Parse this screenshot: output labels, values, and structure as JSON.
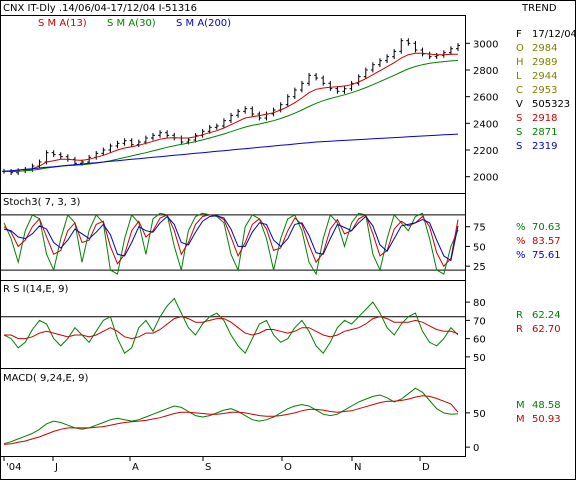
{
  "header": {
    "title": "CNX IT-Dly .14/06/04-17/12/04  I-51316",
    "trend": "TREND"
  },
  "colors": {
    "price": "#000000",
    "sma13": "#cc0000",
    "sma30": "#008000",
    "sma200": "#0000cc",
    "olive": "#808000",
    "frame": "#000000",
    "background": "#ffffff"
  },
  "chart_data": [
    {
      "type": "line",
      "panel": "price",
      "series_labels": [
        {
          "name": "S M A(13)",
          "color": "#cc0000"
        },
        {
          "name": "S M A(30)",
          "color": "#008000"
        },
        {
          "name": "S M A(200)",
          "color": "#0000cc"
        }
      ],
      "ylim": [
        1900,
        3100
      ],
      "yticks": [
        2000,
        2200,
        2400,
        2600,
        2800,
        3000
      ],
      "grid": false,
      "close": [
        2040,
        2030,
        2045,
        2055,
        2080,
        2110,
        2180,
        2165,
        2150,
        2130,
        2100,
        2110,
        2145,
        2175,
        2200,
        2230,
        2250,
        2270,
        2240,
        2260,
        2290,
        2310,
        2330,
        2310,
        2290,
        2260,
        2275,
        2310,
        2340,
        2370,
        2380,
        2420,
        2460,
        2490,
        2510,
        2470,
        2440,
        2470,
        2500,
        2540,
        2600,
        2650,
        2700,
        2760,
        2740,
        2700,
        2660,
        2640,
        2660,
        2700,
        2750,
        2800,
        2840,
        2870,
        2900,
        2940,
        3020,
        3000,
        2950,
        2920,
        2900,
        2910,
        2930,
        2960,
        2984
      ],
      "sma13": [
        2040,
        2038,
        2040,
        2045,
        2060,
        2080,
        2110,
        2120,
        2130,
        2130,
        2125,
        2122,
        2130,
        2145,
        2160,
        2180,
        2200,
        2215,
        2225,
        2235,
        2250,
        2265,
        2280,
        2290,
        2292,
        2290,
        2290,
        2300,
        2315,
        2330,
        2345,
        2365,
        2390,
        2415,
        2440,
        2450,
        2458,
        2468,
        2480,
        2500,
        2525,
        2555,
        2590,
        2630,
        2655,
        2665,
        2670,
        2675,
        2680,
        2690,
        2710,
        2735,
        2765,
        2795,
        2825,
        2855,
        2890,
        2915,
        2925,
        2925,
        2920,
        2915,
        2915,
        2918,
        2918
      ],
      "sma30": [
        2040,
        2040,
        2042,
        2044,
        2048,
        2055,
        2065,
        2072,
        2078,
        2083,
        2086,
        2090,
        2095,
        2102,
        2110,
        2120,
        2132,
        2144,
        2156,
        2168,
        2180,
        2193,
        2207,
        2220,
        2232,
        2242,
        2252,
        2263,
        2276,
        2290,
        2305,
        2320,
        2337,
        2355,
        2372,
        2385,
        2395,
        2407,
        2420,
        2436,
        2455,
        2476,
        2500,
        2526,
        2550,
        2570,
        2586,
        2600,
        2614,
        2630,
        2648,
        2668,
        2690,
        2713,
        2737,
        2760,
        2785,
        2808,
        2826,
        2840,
        2850,
        2857,
        2863,
        2868,
        2871
      ],
      "sma200": [
        2040,
        2045,
        2050,
        2055,
        2060,
        2065,
        2070,
        2075,
        2080,
        2085,
        2090,
        2095,
        2100,
        2105,
        2110,
        2115,
        2120,
        2125,
        2130,
        2135,
        2140,
        2145,
        2150,
        2155,
        2160,
        2165,
        2170,
        2175,
        2180,
        2185,
        2190,
        2195,
        2200,
        2205,
        2210,
        2215,
        2220,
        2225,
        2230,
        2235,
        2240,
        2245,
        2250,
        2255,
        2260,
        2263,
        2266,
        2269,
        2272,
        2275,
        2278,
        2281,
        2284,
        2287,
        2290,
        2293,
        2296,
        2299,
        2302,
        2305,
        2308,
        2311,
        2314,
        2316,
        2319
      ],
      "readout": [
        {
          "label": "F",
          "value": "17/12/04",
          "color": "#000000"
        },
        {
          "label": "O",
          "value": "2984",
          "color": "#808000"
        },
        {
          "label": "H",
          "value": "2989",
          "color": "#808000"
        },
        {
          "label": "L",
          "value": "2944",
          "color": "#808000"
        },
        {
          "label": "C",
          "value": "2953",
          "color": "#808000"
        },
        {
          "label": "V",
          "value": "505323",
          "color": "#000000"
        },
        {
          "label": "S",
          "value": "2918",
          "color": "#cc0000"
        },
        {
          "label": "S",
          "value": "2871",
          "color": "#008000"
        },
        {
          "label": "S",
          "value": "2319",
          "color": "#0000cc"
        }
      ]
    },
    {
      "type": "line",
      "panel": "stochastic",
      "title": "Stoch3( 7, 3, 3)",
      "ylim": [
        10,
        100
      ],
      "yticks": [
        25,
        50,
        75
      ],
      "hlines": [
        90,
        20
      ],
      "fast_k": [
        80,
        60,
        30,
        70,
        90,
        85,
        40,
        20,
        60,
        90,
        80,
        30,
        70,
        90,
        80,
        20,
        15,
        60,
        90,
        80,
        40,
        85,
        92,
        90,
        50,
        20,
        70,
        88,
        92,
        90,
        88,
        80,
        40,
        20,
        75,
        90,
        85,
        60,
        20,
        60,
        85,
        90,
        70,
        30,
        15,
        60,
        90,
        80,
        50,
        80,
        92,
        90,
        40,
        20,
        60,
        90,
        80,
        70,
        88,
        92,
        60,
        20,
        15,
        50,
        71
      ],
      "slow_k": [
        75,
        68,
        50,
        58,
        75,
        85,
        62,
        40,
        45,
        70,
        80,
        55,
        58,
        78,
        82,
        50,
        28,
        40,
        70,
        82,
        62,
        70,
        86,
        90,
        70,
        40,
        55,
        78,
        88,
        90,
        89,
        84,
        62,
        38,
        55,
        78,
        85,
        72,
        45,
        48,
        70,
        86,
        78,
        52,
        30,
        42,
        72,
        84,
        66,
        70,
        85,
        90,
        66,
        38,
        45,
        72,
        82,
        76,
        80,
        88,
        75,
        42,
        25,
        35,
        84
      ],
      "slow_d": [
        72,
        70,
        62,
        60,
        66,
        76,
        72,
        55,
        48,
        58,
        72,
        66,
        60,
        68,
        78,
        65,
        40,
        38,
        55,
        75,
        70,
        68,
        80,
        88,
        78,
        55,
        52,
        68,
        82,
        88,
        89,
        86,
        72,
        50,
        50,
        68,
        80,
        78,
        58,
        50,
        60,
        78,
        80,
        64,
        42,
        40,
        60,
        78,
        74,
        70,
        80,
        88,
        76,
        52,
        44,
        60,
        76,
        78,
        80,
        84,
        80,
        58,
        38,
        32,
        76
      ],
      "readout": [
        {
          "label": "%",
          "value": "70.63",
          "color": "#008000"
        },
        {
          "label": "%",
          "value": "83.57",
          "color": "#cc0000"
        },
        {
          "label": "%",
          "value": "75.61",
          "color": "#0000cc"
        }
      ]
    },
    {
      "type": "line",
      "panel": "rsi",
      "title": "R S I(14,E, 9)",
      "ylim": [
        45,
        85
      ],
      "yticks": [
        50,
        60,
        70,
        80
      ],
      "hlines": [
        72
      ],
      "rsi": [
        62,
        60,
        55,
        58,
        65,
        70,
        68,
        60,
        56,
        60,
        66,
        62,
        58,
        64,
        70,
        72,
        60,
        52,
        55,
        66,
        70,
        64,
        72,
        78,
        82,
        74,
        66,
        62,
        68,
        72,
        74,
        70,
        62,
        56,
        52,
        60,
        68,
        70,
        62,
        58,
        60,
        66,
        70,
        64,
        56,
        52,
        58,
        66,
        70,
        68,
        72,
        76,
        80,
        74,
        66,
        62,
        68,
        72,
        74,
        64,
        58,
        56,
        60,
        66,
        62
      ],
      "ema": [
        62,
        62,
        60,
        60,
        61,
        63,
        64,
        63,
        62,
        61,
        62,
        62,
        61,
        62,
        64,
        66,
        64,
        61,
        60,
        61,
        63,
        63,
        65,
        68,
        71,
        72,
        71,
        69,
        69,
        70,
        71,
        71,
        69,
        66,
        63,
        62,
        63,
        65,
        65,
        64,
        63,
        64,
        66,
        66,
        64,
        62,
        61,
        62,
        64,
        65,
        66,
        68,
        71,
        72,
        71,
        69,
        69,
        69,
        70,
        69,
        67,
        65,
        64,
        64,
        62.7
      ],
      "readout": [
        {
          "label": "R",
          "value": "62.24",
          "color": "#008000"
        },
        {
          "label": "R",
          "value": "62.70",
          "color": "#cc0000"
        }
      ]
    },
    {
      "type": "line",
      "panel": "macd",
      "title": "MACD( 9,24,E, 9)",
      "ylim": [
        -10,
        95
      ],
      "yticks": [
        0,
        50
      ],
      "categories": [
        "'04",
        "J",
        "A",
        "S",
        "O",
        "N",
        "D"
      ],
      "macd": [
        5,
        8,
        12,
        16,
        20,
        26,
        34,
        38,
        36,
        32,
        28,
        26,
        28,
        32,
        36,
        40,
        42,
        40,
        38,
        40,
        44,
        48,
        52,
        56,
        60,
        58,
        52,
        46,
        44,
        46,
        50,
        54,
        56,
        52,
        46,
        40,
        38,
        40,
        44,
        50,
        56,
        60,
        62,
        60,
        54,
        48,
        46,
        48,
        54,
        60,
        66,
        70,
        74,
        76,
        72,
        66,
        70,
        78,
        86,
        80,
        68,
        56,
        50,
        48,
        48.58
      ],
      "signal": [
        4,
        5,
        7,
        9,
        12,
        15,
        19,
        23,
        26,
        28,
        28,
        28,
        28,
        29,
        30,
        32,
        34,
        36,
        37,
        38,
        39,
        41,
        43,
        46,
        49,
        51,
        51,
        50,
        49,
        48,
        48,
        49,
        51,
        51,
        50,
        48,
        46,
        45,
        45,
        46,
        48,
        50,
        53,
        55,
        55,
        54,
        52,
        51,
        52,
        53,
        56,
        59,
        62,
        65,
        67,
        67,
        68,
        70,
        73,
        75,
        74,
        71,
        67,
        63,
        50.93
      ],
      "readout": [
        {
          "label": "M",
          "value": "48.58",
          "color": "#008000"
        },
        {
          "label": "M",
          "value": "50.93",
          "color": "#cc0000"
        }
      ]
    }
  ]
}
